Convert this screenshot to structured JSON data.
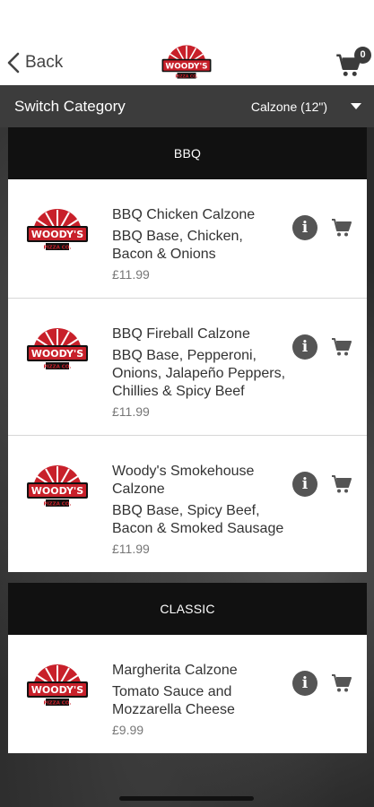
{
  "nav": {
    "back_label": "Back",
    "logo_text": "WOODY'S",
    "logo_subtext": "PIZZA CO.",
    "cart_count": "0"
  },
  "switch": {
    "label": "Switch Category",
    "selected": "Calzone (12\")"
  },
  "categories": [
    {
      "name": "BBQ",
      "items": [
        {
          "name": "BBQ Chicken Calzone",
          "desc": "BBQ Base, Chicken, Bacon & Onions",
          "price": "£11.99"
        },
        {
          "name": "BBQ Fireball Calzone",
          "desc": "BBQ Base, Pepperoni, Onions, Jalapeño Peppers, Chillies & Spicy Beef",
          "price": "£11.99"
        },
        {
          "name": "Woody's Smokehouse Calzone",
          "desc": "BBQ Base, Spicy Beef, Bacon & Smoked Sausage",
          "price": "£11.99"
        }
      ]
    },
    {
      "name": "CLASSIC",
      "items": [
        {
          "name": "Margherita Calzone",
          "desc": "Tomato Sauce and Mozzarella Cheese",
          "price": "£9.99"
        }
      ]
    }
  ],
  "colors": {
    "header_bg": "#111111",
    "switch_bg": "#3c3c3c",
    "logo_red": "#c8202a",
    "icon_gray": "#555555"
  }
}
